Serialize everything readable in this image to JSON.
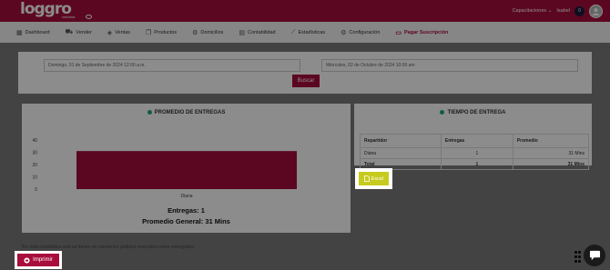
{
  "header": {
    "logo_text": "loggro",
    "logo_sub": "restobar",
    "company_menu": "Capacitaciones",
    "user_name": "Isabel",
    "notification_count": "0"
  },
  "nav": {
    "items": [
      {
        "label": "Dashboard",
        "icon": "dashboard-icon"
      },
      {
        "label": "Vender",
        "icon": "cart-icon"
      },
      {
        "label": "Ventas",
        "icon": "tag-icon"
      },
      {
        "label": "Productos",
        "icon": "box-icon"
      },
      {
        "label": "Domicilios",
        "icon": "motorbike-icon"
      },
      {
        "label": "Contabilidad",
        "icon": "calculator-icon"
      },
      {
        "label": "Estadísticas",
        "icon": "chart-line-icon"
      },
      {
        "label": "Configuración",
        "icon": "gear-icon"
      },
      {
        "label": "Pagar Suscripción",
        "icon": "credit-card-icon"
      }
    ]
  },
  "filters": {
    "start_date": "Domingo, 01 de Septiembre de 2024 12:00 a.m.",
    "end_date": "Miércoles, 02 de Octubre de 2024 10:00 am",
    "search_button": "Buscar"
  },
  "left_card": {
    "title": "PROMEDIO DE ENTREGAS",
    "deliveries_label": "Entregas: 1",
    "average_label": "Promedio General: 31 Mins"
  },
  "chart_data": {
    "type": "bar",
    "categories": [
      "Diana"
    ],
    "values": [
      31
    ],
    "ylim": [
      0,
      40
    ],
    "yticks": [
      0,
      10,
      20,
      30,
      40
    ],
    "bar_color": "#a80d3c",
    "grid": false,
    "title": "",
    "xlabel": "",
    "ylabel": ""
  },
  "right_card": {
    "title": "TIEMPO DE ENTREGA",
    "columns": [
      "Repartidor",
      "Entregas",
      "Promedio"
    ],
    "rows": [
      [
        "Diana",
        "1",
        "31 Mins"
      ]
    ],
    "total_row": [
      "Total",
      "1",
      "31 Mins"
    ],
    "excel_button": "Excel"
  },
  "footnote": "*En esta estadística solo se tienen en cuenta los pedidos marcados como entregados.",
  "print_button": "Imprimir",
  "colors": {
    "brand": "#a80d3c",
    "accent_dot": "#1fa58a",
    "excel": "#c7cb1e"
  }
}
